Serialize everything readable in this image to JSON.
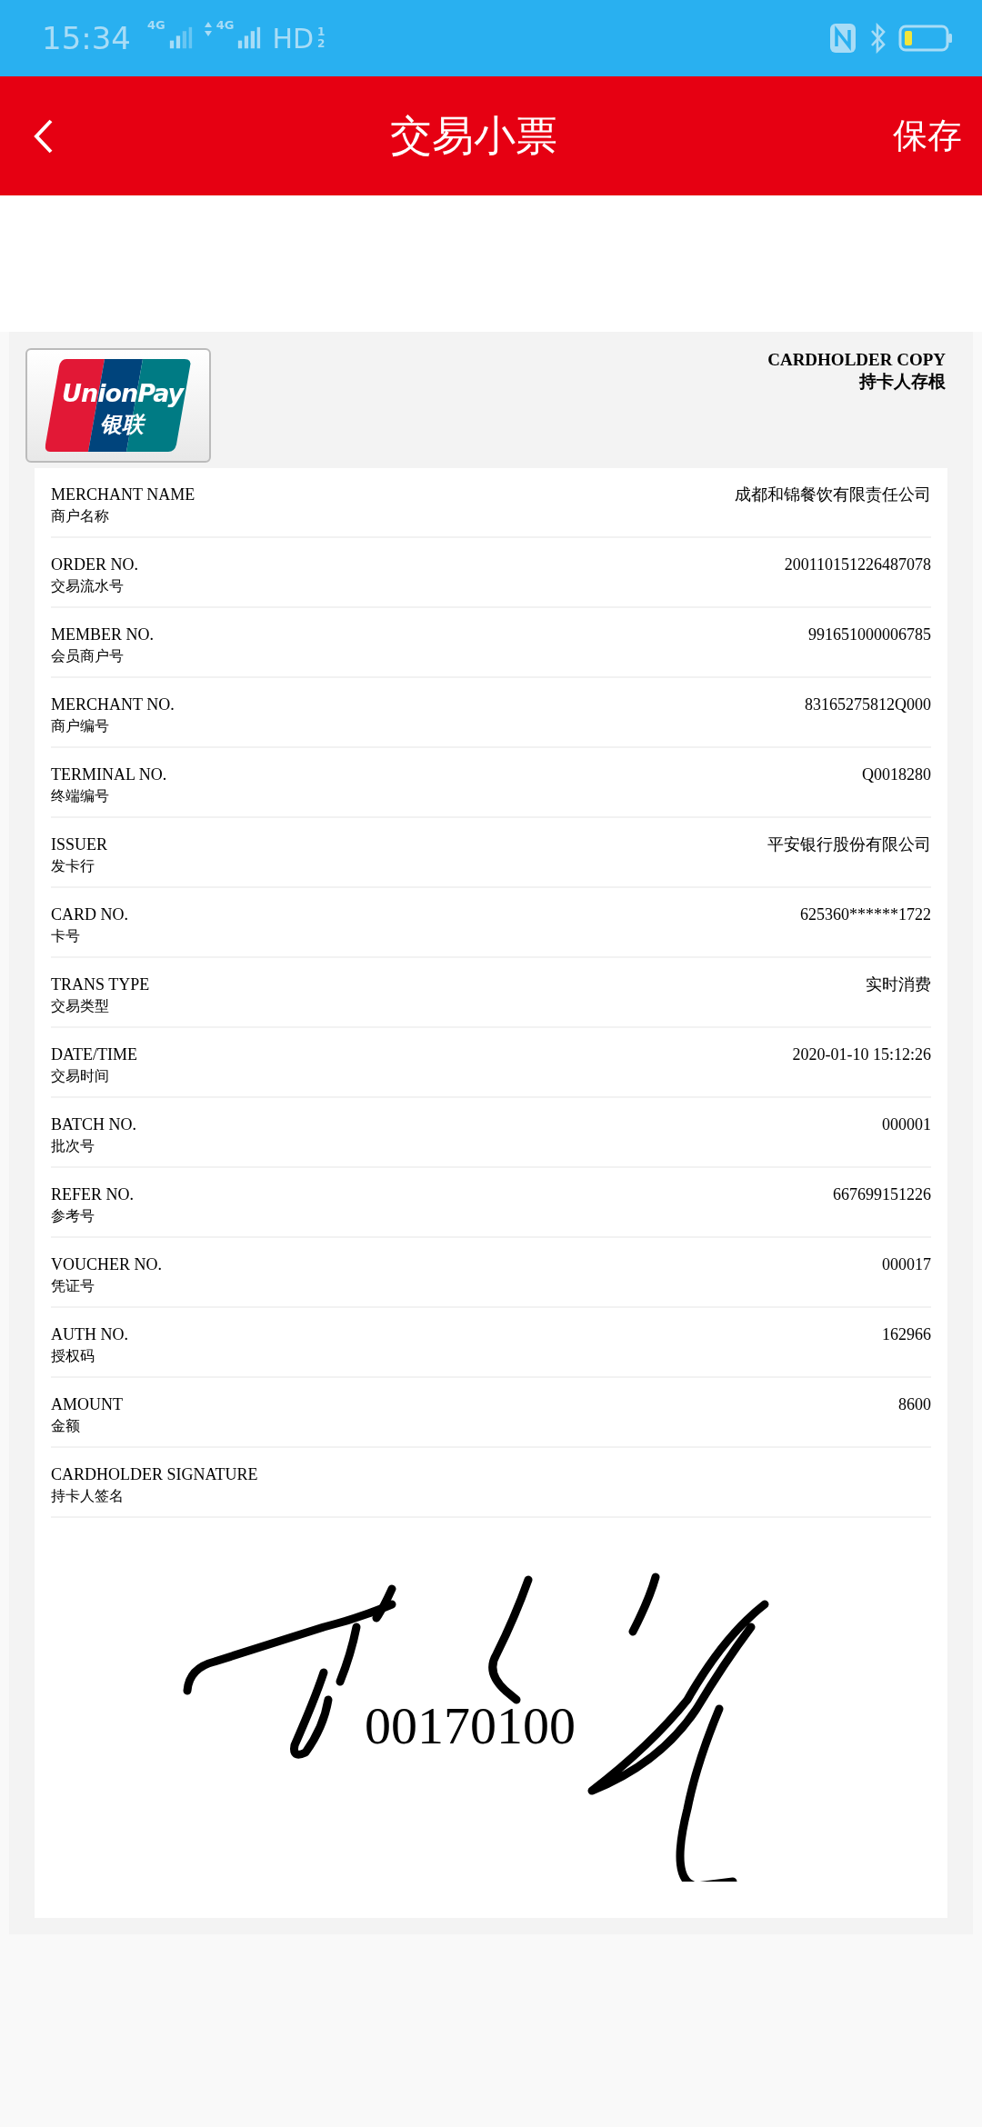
{
  "status_bar": {
    "time": "15:34",
    "sim1": "4G",
    "sim2": "4G",
    "hd": "HD",
    "hd_slots": [
      "1",
      "2"
    ]
  },
  "header": {
    "title": "交易小票",
    "action": "保存"
  },
  "receipt": {
    "logo_en": "UnionPay",
    "logo_zh": "银联",
    "copy_en": "CARDHOLDER COPY",
    "copy_zh": "持卡人存根",
    "rows": [
      {
        "label_en": "MERCHANT NAME",
        "label_zh": "商户名称",
        "value": "成都和锦餐饮有限责任公司"
      },
      {
        "label_en": "ORDER NO.",
        "label_zh": "交易流水号",
        "value": "200110151226487078"
      },
      {
        "label_en": "MEMBER NO.",
        "label_zh": "会员商户号",
        "value": "991651000006785"
      },
      {
        "label_en": "MERCHANT NO.",
        "label_zh": "商户编号",
        "value": "83165275812Q000"
      },
      {
        "label_en": "TERMINAL NO.",
        "label_zh": "终端编号",
        "value": "Q0018280"
      },
      {
        "label_en": "ISSUER",
        "label_zh": "发卡行",
        "value": "平安银行股份有限公司"
      },
      {
        "label_en": "CARD NO.",
        "label_zh": "卡号",
        "value": "625360******1722"
      },
      {
        "label_en": "TRANS TYPE",
        "label_zh": "交易类型",
        "value": "实时消费"
      },
      {
        "label_en": "DATE/TIME",
        "label_zh": "交易时间",
        "value": "2020-01-10 15:12:26"
      },
      {
        "label_en": "BATCH NO.",
        "label_zh": "批次号",
        "value": "000001"
      },
      {
        "label_en": "REFER NO.",
        "label_zh": "参考号",
        "value": "667699151226"
      },
      {
        "label_en": "VOUCHER NO.",
        "label_zh": "凭证号",
        "value": "000017"
      },
      {
        "label_en": "AUTH NO.",
        "label_zh": "授权码",
        "value": "162966"
      },
      {
        "label_en": "AMOUNT",
        "label_zh": "金额",
        "value": "8600"
      },
      {
        "label_en": "CARDHOLDER SIGNATURE",
        "label_zh": "持卡人签名"
      }
    ],
    "signature_stamp": "00170100"
  }
}
